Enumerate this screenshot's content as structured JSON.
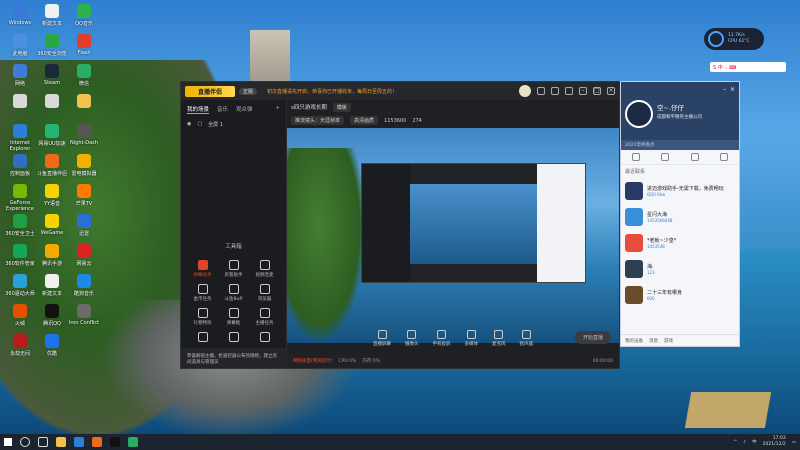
{
  "desktop": {
    "icons": [
      {
        "label": "Windows",
        "color": "#3c78d8"
      },
      {
        "label": "新建文本",
        "color": "#f0f0f0"
      },
      {
        "label": "QQ音乐",
        "color": "#2bb24c"
      },
      {
        "label": "此电脑",
        "color": "#4a90e2"
      },
      {
        "label": "360安全浏览",
        "color": "#27a844"
      },
      {
        "label": "Flash",
        "color": "#e23c2c"
      },
      {
        "label": "网络",
        "color": "#3b7dd8"
      },
      {
        "label": "Steam",
        "color": "#1b2838"
      },
      {
        "label": "微信",
        "color": "#2aae67"
      },
      {
        "label": "",
        "color": "#d9d9d9"
      },
      {
        "label": "",
        "color": "#d9d9d9"
      },
      {
        "label": "",
        "color": "#f2c14e"
      },
      {
        "label": "Internet Explorer",
        "color": "#2d7ed8"
      },
      {
        "label": "网易UU加速",
        "color": "#22b573"
      },
      {
        "label": "Night-Dash",
        "color": "#555"
      },
      {
        "label": "控制面板",
        "color": "#2e6fc0"
      },
      {
        "label": "斗鱼直播伴侣",
        "color": "#ef6b1a"
      },
      {
        "label": "雷电模拟器",
        "color": "#f2b100"
      },
      {
        "label": "GeForce Experience",
        "color": "#76b900"
      },
      {
        "label": "YY语音",
        "color": "#f6d200"
      },
      {
        "label": "芒果TV",
        "color": "#ff7a00"
      },
      {
        "label": "360安全卫士",
        "color": "#1f9e46"
      },
      {
        "label": "WeGame",
        "color": "#f5d200"
      },
      {
        "label": "迅雷",
        "color": "#2a6fd8"
      },
      {
        "label": "360软件管家",
        "color": "#12a65a"
      },
      {
        "label": "腾讯手游",
        "color": "#f2a900"
      },
      {
        "label": "网易云",
        "color": "#d22"
      },
      {
        "label": "360驱动大师",
        "color": "#2a9fd8"
      },
      {
        "label": "新建文本",
        "color": "#f0f0f0"
      },
      {
        "label": "酷狗音乐",
        "color": "#1e88e5"
      },
      {
        "label": "火绒",
        "color": "#e65100"
      },
      {
        "label": "腾讯QQ",
        "color": "#111"
      },
      {
        "label": "Iron Conflict",
        "color": "#6a6a6a"
      },
      {
        "label": "永劫无间",
        "color": "#b71c1c"
      },
      {
        "label": "优酷",
        "color": "#1a73e8"
      }
    ]
  },
  "main_window": {
    "app_logo": "直播伴侣",
    "version": "正版",
    "notice": "初次直播请先开启，恭喜你已开播收米，每周日至周五的！",
    "left_tabs": [
      "我的场景",
      "音乐",
      "观众弹"
    ],
    "scene_label": "全屏 1",
    "tools_title": "工具箱",
    "tools": [
      {
        "label": "弹幕助手",
        "hot": true
      },
      {
        "label": "房管助手",
        "hot": false
      },
      {
        "label": "视频连麦",
        "hot": false
      },
      {
        "label": "金币任务",
        "hot": false
      },
      {
        "label": "斗鱼Buff",
        "hot": false
      },
      {
        "label": "浏览器",
        "hot": false
      },
      {
        "label": "礼物特效",
        "hot": false
      },
      {
        "label": "弹幕框",
        "hot": false
      },
      {
        "label": "主播任务",
        "hot": false
      },
      {
        "label": "",
        "hot": false
      },
      {
        "label": "",
        "hot": false
      },
      {
        "label": "",
        "hot": false
      }
    ],
    "left_footer": "恭喜解锁主播，抢遥控器公布热销榜，建立房间道具与管理员",
    "room_title": "s四只游戏长期",
    "room_btn": "模板",
    "stream_info": "推流镜头：天涯帧率",
    "quality_btn": "高清画质",
    "fps": "1153600",
    "heat": "274",
    "controls": [
      "直播屏幕",
      "摄像头",
      "手机投屏",
      "多媒体",
      "麦克风",
      "扬声器"
    ],
    "start_btn": "开始直播",
    "status_warn": "网络质量(网络延时)",
    "status_cpu": "CPU:0%",
    "status_mem": "内存:0%",
    "status_time": "00:00:00"
  },
  "qq_panel": {
    "username": "空~.仔仔",
    "signature": "成都和平精英主播公司",
    "search_placeholder": "2021年终盘点",
    "section": "最近联系",
    "items": [
      {
        "name": "进迈游戏助手-无需下载，免费畅玩",
        "sub": "QQ0 6kw",
        "color": "#2a3a66"
      },
      {
        "name": "星闪大海",
        "sub": "1453566448",
        "color": "#3a90d8"
      },
      {
        "name": "*老板~少皇*",
        "sub": "1453548",
        "color": "#e74c3c"
      },
      {
        "name": "海.",
        "sub": "123",
        "color": "#2c3e50"
      },
      {
        "name": "二十三年有哪身",
        "sub": "000",
        "color": "#6b4b2a"
      }
    ],
    "footer": [
      "我的设备",
      "消息",
      "游戏"
    ]
  },
  "sysmon": {
    "net": "11.7K/s",
    "cpu": "CPU 61°C"
  },
  "ime": "S 中 ·, ⌨",
  "taskbar": {
    "time": "17:03",
    "date": "2021/12/2",
    "lang": "中"
  }
}
